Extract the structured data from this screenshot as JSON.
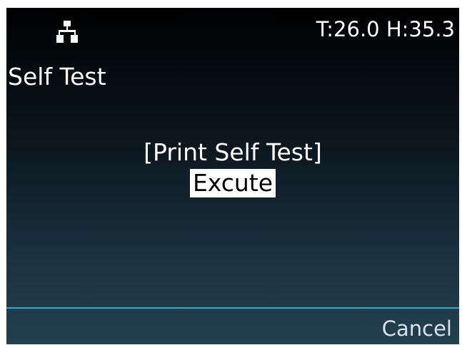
{
  "status_bar": {
    "network_icon": "network-icon",
    "env_readout": "T:26.0 H:35.3"
  },
  "page": {
    "title": "Self Test"
  },
  "menu": {
    "title": "[Print Self Test]",
    "options": [
      {
        "label": "Excute",
        "selected": true
      }
    ]
  },
  "footer": {
    "cancel_label": "Cancel"
  },
  "colors": {
    "background_top": "#000000",
    "background_bottom": "#23404f",
    "divider": "#3aa8c8",
    "highlight": "#ffffff",
    "text": "#ffffff"
  }
}
